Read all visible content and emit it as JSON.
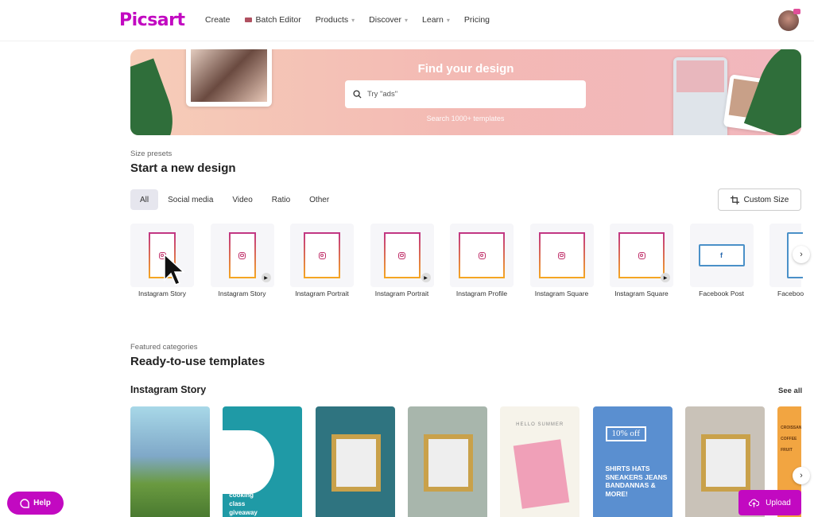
{
  "nav": {
    "logo": "Picsart",
    "items": [
      {
        "label": "Create"
      },
      {
        "label": "Batch Editor"
      },
      {
        "label": "Products"
      },
      {
        "label": "Discover"
      },
      {
        "label": "Learn"
      },
      {
        "label": "Pricing"
      }
    ]
  },
  "banner": {
    "title": "Find your design",
    "search_placeholder": "Try \"ads\"",
    "subtitle": "Search 1000+ templates"
  },
  "presets": {
    "eyebrow": "Size presets",
    "title": "Start a new design",
    "tabs": [
      "All",
      "Social media",
      "Video",
      "Ratio",
      "Other"
    ],
    "active_tab": "All",
    "custom_size": "Custom Size",
    "items": [
      {
        "label": "Instagram Story",
        "icon": "instagram-icon",
        "video": false
      },
      {
        "label": "Instagram Story",
        "icon": "instagram-icon",
        "video": true
      },
      {
        "label": "Instagram Portrait",
        "icon": "instagram-icon",
        "video": false
      },
      {
        "label": "Instagram Portrait",
        "icon": "instagram-icon",
        "video": true
      },
      {
        "label": "Instagram Profile",
        "icon": "instagram-icon",
        "video": false
      },
      {
        "label": "Instagram Square",
        "icon": "instagram-icon",
        "video": false
      },
      {
        "label": "Instagram Square",
        "icon": "instagram-icon",
        "video": true
      },
      {
        "label": "Facebook Post",
        "icon": "facebook-icon",
        "video": false
      },
      {
        "label": "Faceboo",
        "icon": "facebook-icon",
        "video": false
      }
    ]
  },
  "templates": {
    "eyebrow": "Featured categories",
    "title": "Ready-to-use templates",
    "section": "Instagram Story",
    "see_all": "See all",
    "cards": [
      {
        "text": "",
        "bg": "#8fc6d8"
      },
      {
        "text": "cooking class giveaway",
        "bg": "#1f9aa6"
      },
      {
        "text": "",
        "bg": "#2f7480"
      },
      {
        "text": "",
        "bg": "#a8b6ac"
      },
      {
        "text": "HELLO SUMMER",
        "bg": "#f6f3ea"
      },
      {
        "text": "10% off",
        "list": "SHIRTS HATS SNEAKERS JEANS BANDANNAS & MORE!",
        "bg": "#5a8fd0"
      },
      {
        "text": "",
        "bg": "#c9c2b8"
      },
      {
        "text": "CROISSANT COFFEE FRUIT",
        "bg": "#f2a541"
      }
    ]
  },
  "help": "Help",
  "upload": "Upload",
  "colors": {
    "brand": "#c209c1"
  }
}
